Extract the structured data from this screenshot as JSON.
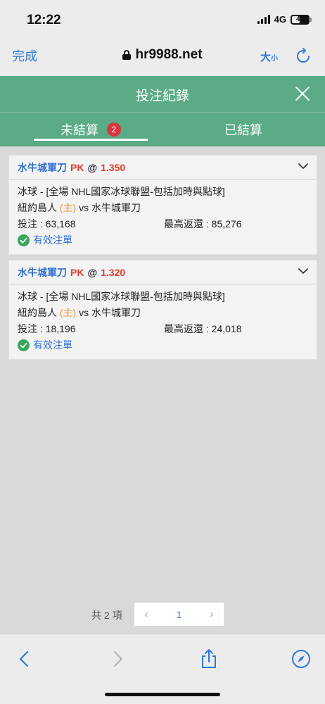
{
  "status_bar": {
    "time": "12:22",
    "network": "4G",
    "battery": "41"
  },
  "browser": {
    "done_label": "完成",
    "url": "hr9988.net",
    "text_size_big": "大",
    "text_size_small": "小"
  },
  "modal": {
    "title": "投注紀錄",
    "tabs": [
      {
        "label": "未結算",
        "badge": "2",
        "active": true
      },
      {
        "label": "已結算",
        "active": false
      }
    ]
  },
  "bets": [
    {
      "team": "水牛城軍刀",
      "handicap": "PK",
      "at": "@",
      "odds": "1.350",
      "league": "冰球 - [全場 NHL國家冰球聯盟-包括加時與點球]",
      "home_team": "紐約島人",
      "home_tag": "(主)",
      "vs_text": "vs 水牛城軍刀",
      "stake": "投注 : 63,168",
      "max_return": "最高返還 : 85,276",
      "status": "有效注單"
    },
    {
      "team": "水牛城軍刀",
      "handicap": "PK",
      "at": "@",
      "odds": "1.320",
      "league": "冰球 - [全場 NHL國家冰球聯盟-包括加時與點球]",
      "home_team": "紐約島人",
      "home_tag": "(主)",
      "vs_text": "vs 水牛城軍刀",
      "stake": "投注 : 18,196",
      "max_return": "最高返還 : 24,018",
      "status": "有效注單"
    }
  ],
  "pagination": {
    "total": "共 2 項",
    "prev": "‹",
    "current": "1",
    "next": "›"
  },
  "colors": {
    "header_green": "#5aab86",
    "link_blue": "#2f6fd0",
    "odds_red": "#e03c2e",
    "badge_red": "#d9363e",
    "home_orange": "#e9953c",
    "check_green": "#3aa65c"
  },
  "icons": {
    "lock": "lock-icon",
    "reload": "reload-icon",
    "close": "close-icon",
    "chevron": "chevron-down-icon",
    "check": "check-circle-icon",
    "back": "back-arrow-icon",
    "forward": "forward-arrow-icon",
    "share": "share-icon",
    "compass": "compass-icon"
  }
}
